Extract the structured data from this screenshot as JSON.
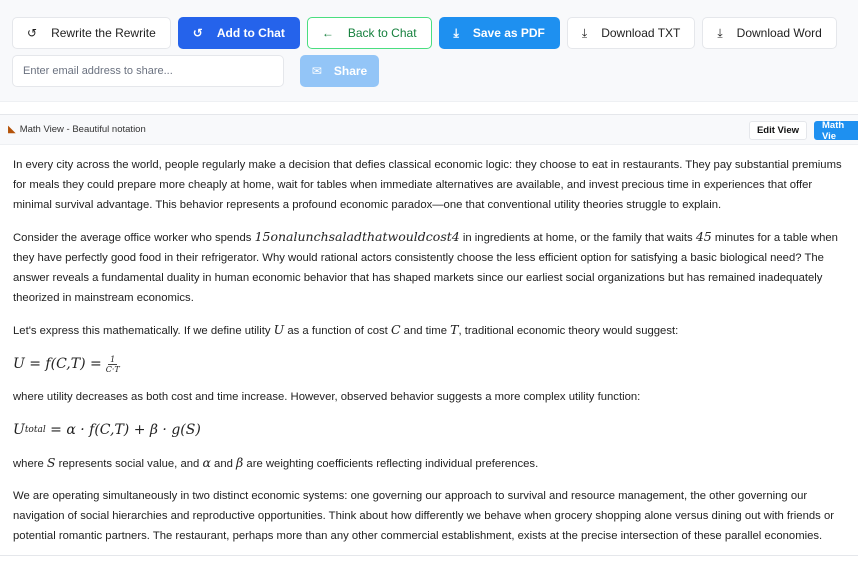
{
  "toolbar": {
    "rewrite": "Rewrite the Rewrite",
    "add_chat": "Add to Chat",
    "back_chat": "Back to Chat",
    "save_pdf": "Save as PDF",
    "download_txt": "Download TXT",
    "download_word": "Download Word",
    "email_placeholder": "Enter email address to share...",
    "share": "Share",
    "icons": {
      "rewrite": "rotate-ccw-icon",
      "add_chat": "rotate-ccw-icon",
      "back": "arrow-left-icon",
      "save_pdf": "download-icon",
      "txt": "download-icon",
      "word": "download-icon",
      "share": "mail-icon"
    }
  },
  "view": {
    "title": "Math View - Beautiful notation",
    "edit_view": "Edit View",
    "math_view": "Math Vie"
  },
  "colors": {
    "primary": "#2563eb",
    "accent": "#1e90f0",
    "green": "#15803d"
  },
  "content": {
    "p1": "In every city across the world, people regularly make a decision that defies classical economic logic: they choose to eat in restaurants. They pay substantial premiums for meals they could prepare more cheaply at home, wait for tables when immediate alternatives are available, and invest precious time in experiences that offer minimal survival advantage. This behavior represents a profound economic paradox—one that conventional utility theories struggle to explain.",
    "p2a": "Consider the average office worker who spends ",
    "p2m1": "15onalunchsaladthatwouldcost4",
    "p2b": " in ingredients at home, or the family that waits ",
    "p2m2": "45",
    "p2c": " minutes for a table when they have perfectly good food in their refrigerator. Why would rational actors consistently choose the less efficient option for satisfying a basic biological need? The answer reveals a fundamental duality in human economic behavior that has shaped markets since our earliest social organizations but has remained inadequately theorized in mainstream economics.",
    "p3a": "Let's express this mathematically. If we define utility ",
    "p3m1": "U",
    "p3b": " as a function of cost ",
    "p3m2": "C",
    "p3c": " and time ",
    "p3m3": "T",
    "p3d": ", traditional economic theory would suggest:",
    "eq1": "U = f(C,T) =",
    "eq1_num": "1",
    "eq1_den": "C·T",
    "p4": "where utility decreases as both cost and time increase. However, observed behavior suggests a more complex utility function:",
    "eq2_u": "U",
    "eq2_sub": "total",
    "eq2_rest": " = α · f(C,T) + β · g(S)",
    "p5a": "where ",
    "p5m1": "S",
    "p5b": " represents social value, and ",
    "p5m2": "α",
    "p5c": " and ",
    "p5m3": "β",
    "p5d": " are weighting coefficients reflecting individual preferences.",
    "p6": "We are operating simultaneously in two distinct economic systems: one governing our approach to survival and resource management, the other governing our navigation of social hierarchies and reproductive opportunities. Think about how differently we behave when grocery shopping alone versus dining out with friends or potential romantic partners. The restaurant, perhaps more than any other commercial establishment, exists at the precise intersection of these parallel economies."
  }
}
